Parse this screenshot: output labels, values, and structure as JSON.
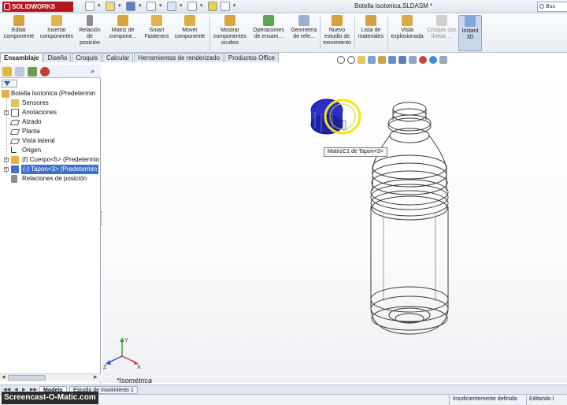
{
  "app": {
    "brand": "SOLIDWORKS",
    "document_title": "Botella Isotonica.SLDASM *",
    "search_label": "Bus"
  },
  "ribbon": {
    "buttons": [
      {
        "label": "Editar componente"
      },
      {
        "label": "Insertar componentes"
      },
      {
        "label": "Relación de posición"
      },
      {
        "label": "Matriz de compone..."
      },
      {
        "label": "Smart Fasteners"
      },
      {
        "label": "Mover componente"
      },
      {
        "label": "Mostrar componentes ocultos"
      },
      {
        "label": "Operaciones de ensam..."
      },
      {
        "label": "Geometría de refe..."
      },
      {
        "label": "Nuevo estudio de movimiento"
      },
      {
        "label": "Lista de materiales"
      },
      {
        "label": "Vista explosionada"
      },
      {
        "label": "Croquis con líneas ..."
      },
      {
        "label": "Instant 3D"
      }
    ]
  },
  "command_tabs": [
    "Ensamblaje",
    "Diseño",
    "Croquis",
    "Calcular",
    "Herramientas de renderizado",
    "Productos Office"
  ],
  "feature_tree": {
    "root": "Botella Isotonica  (Predetermin",
    "items": [
      {
        "label": "Sensores"
      },
      {
        "label": "Anotaciones"
      },
      {
        "label": "Alzado"
      },
      {
        "label": "Planta"
      },
      {
        "label": "Vista lateral"
      },
      {
        "label": "Origen"
      },
      {
        "label": "(f) Cuerpo<5> (Predetermin"
      },
      {
        "label": "(-) Tapon<3> (Predetermin"
      },
      {
        "label": "Relaciones de posición"
      }
    ]
  },
  "graphics": {
    "tooltip": "MatrizC1 de Tapon<3>",
    "view_label": "*Isométrica",
    "triad": {
      "x": "X",
      "y": "Y",
      "z": "Z"
    }
  },
  "bottom_tabs": [
    "Modelo",
    "Estudio de movimiento 1"
  ],
  "status": {
    "definition": "Insuficientemente definida",
    "mode": "Editando l"
  },
  "watermark": "Screencast-O-Matic.com",
  "colors": {
    "brand_red": "#b3161d",
    "selection_blue": "#3f6fc8",
    "cap_blue": "#2a2fc8",
    "highlight_yellow": "#f2e51a"
  }
}
